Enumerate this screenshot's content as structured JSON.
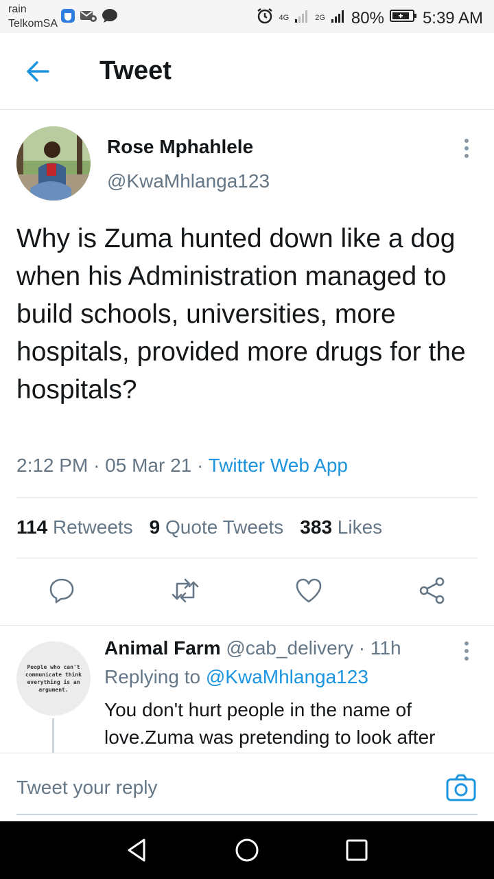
{
  "status_bar": {
    "carrier_top": "rain",
    "carrier_bottom": "TelkomSA",
    "net_4g": "4G",
    "net_2g": "2G",
    "battery": "80%",
    "time": "5:39 AM"
  },
  "header": {
    "title": "Tweet"
  },
  "tweet": {
    "author_name": "Rose Mphahlele",
    "author_handle": "@KwaMhlanga123",
    "text": "Why is Zuma hunted down like a dog when his Administration managed to build schools, universities, more hospitals, provided more drugs for the hospitals?",
    "time": "2:12 PM",
    "date": "05 Mar 21",
    "source": "Twitter Web App",
    "separator": "·",
    "retweets_count": "114",
    "retweets_label": "Retweets",
    "quotes_count": "9",
    "quotes_label": "Quote Tweets",
    "likes_count": "383",
    "likes_label": "Likes"
  },
  "reply": {
    "avatar_text": "People who can't communicate think everything is an argument.",
    "name": "Animal Farm",
    "handle": "@cab_delivery",
    "time": "11h",
    "replying_prefix": "Replying to",
    "replying_to": "@KwaMhlanga123",
    "text": "You don't hurt people in the name of love.Zuma  was pretending to look after"
  },
  "composer": {
    "placeholder": "Tweet your reply"
  },
  "colors": {
    "accent": "#1b95e0",
    "muted": "#657786",
    "text": "#14171a",
    "divider": "#e1e8ed"
  }
}
